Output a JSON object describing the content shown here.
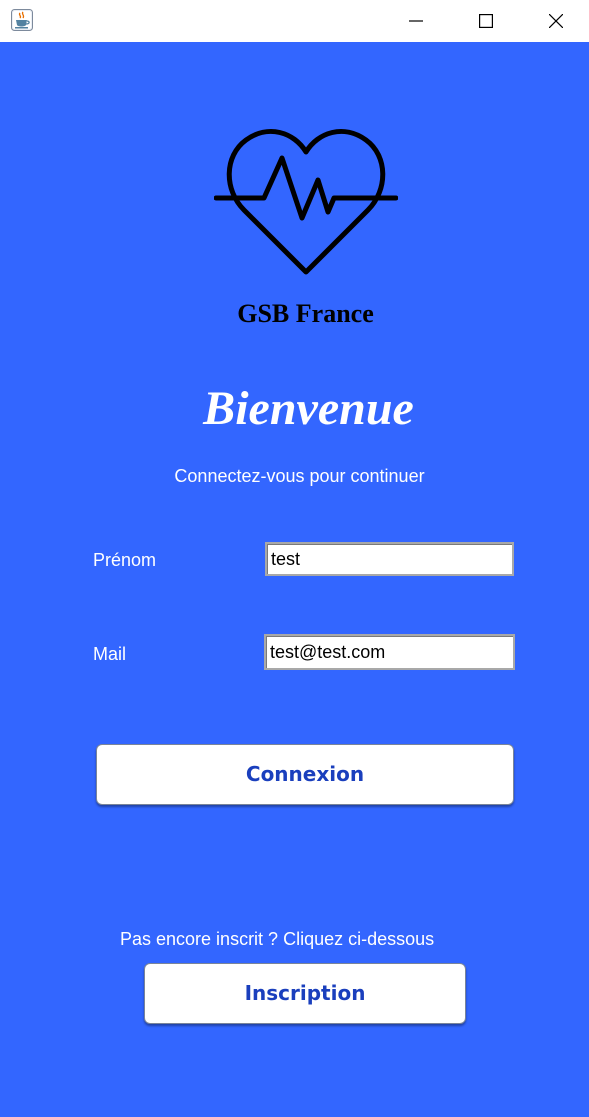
{
  "window": {
    "app_icon": "java-cup-icon",
    "controls": [
      "minimize-icon",
      "maximize-icon",
      "close-icon"
    ]
  },
  "logo": {
    "icon": "heart-pulse-icon",
    "brand_name": "GSB France"
  },
  "welcome": {
    "title": "Bienvenue",
    "subtitle": "Connectez-vous pour continuer"
  },
  "form": {
    "prenom_label": "Prénom",
    "prenom_value": "test",
    "mail_label": "Mail",
    "mail_value": "test@test.com",
    "connexion_label": "Connexion"
  },
  "signup": {
    "hint": "Pas encore inscrit ? Cliquez ci-dessous",
    "inscription_label": "Inscription"
  },
  "colors": {
    "background": "#3366ff",
    "button_text": "#1a3fbd",
    "titlebar": "#ffffff"
  }
}
